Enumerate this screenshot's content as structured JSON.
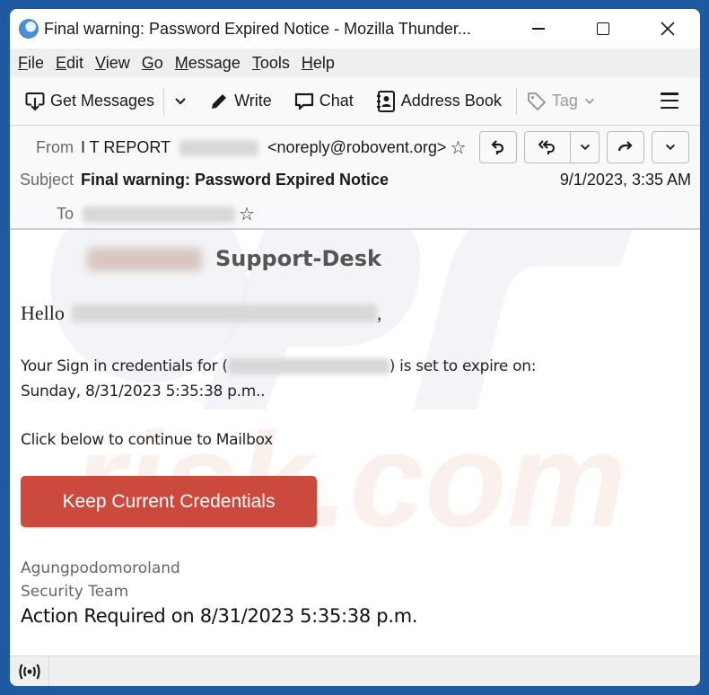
{
  "window": {
    "title": "Final warning: Password Expired Notice - Mozilla Thunder...",
    "controls": {
      "minimize": "minimize",
      "maximize": "maximize",
      "close": "✕"
    }
  },
  "menubar": {
    "items": [
      {
        "label": "File",
        "mnemonic": "F",
        "rest": "ile"
      },
      {
        "label": "Edit",
        "mnemonic": "E",
        "rest": "dit"
      },
      {
        "label": "View",
        "mnemonic": "V",
        "rest": "iew"
      },
      {
        "label": "Go",
        "mnemonic": "G",
        "rest": "o"
      },
      {
        "label": "Message",
        "mnemonic": "M",
        "rest": "essage"
      },
      {
        "label": "Tools",
        "mnemonic": "T",
        "rest": "ools"
      },
      {
        "label": "Help",
        "mnemonic": "H",
        "rest": "elp"
      }
    ]
  },
  "toolbar": {
    "get_messages": "Get Messages",
    "write": "Write",
    "chat": "Chat",
    "address_book": "Address Book",
    "tag": "Tag"
  },
  "header": {
    "from_label": "From",
    "from_name": "I T REPORT",
    "from_email": "<noreply@robovent.org>",
    "subject_label": "Subject",
    "subject": "Final warning: Password Expired Notice",
    "date": "9/1/2023, 3:35 AM",
    "to_label": "To",
    "star": "☆"
  },
  "body": {
    "brand": "Support-Desk",
    "greeting": "Hello",
    "greeting_suffix": ",",
    "para1_prefix": "Your Sign in credentials for (",
    "para1_suffix": ") is set to expire on:",
    "para1_line2": "Sunday, 8/31/2023 5:35:38 p.m..",
    "para2": "Click below to continue to Mailbox",
    "cta": "Keep Current Credentials",
    "sig_line1": "Agungpodomoroland",
    "sig_line2": "Security Team",
    "action_required": "Action Required on 8/31/2023 5:35:38 p.m."
  },
  "colors": {
    "cta_bg": "#cc4a3d",
    "desktop_bg": "#1f5aa0"
  }
}
